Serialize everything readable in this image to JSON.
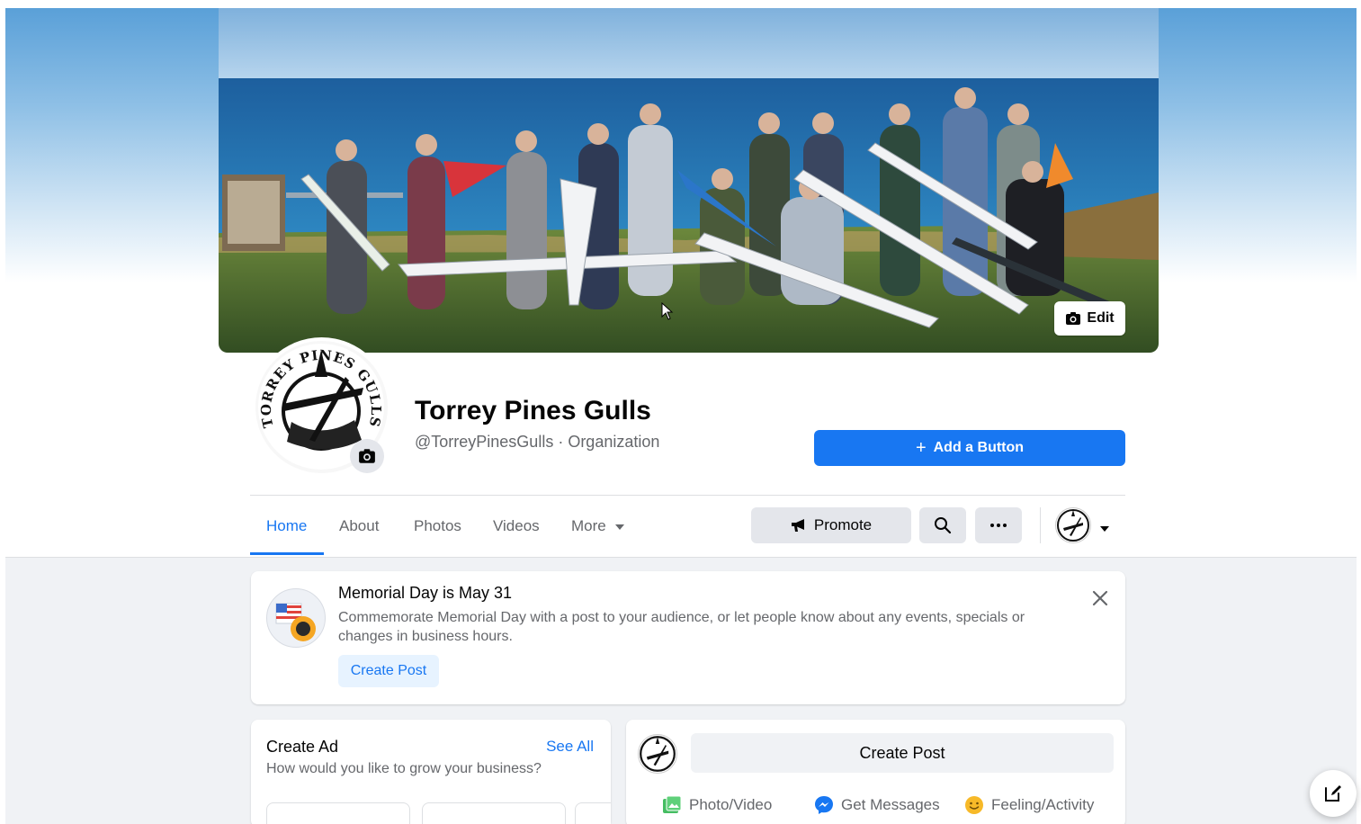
{
  "cover": {
    "edit_label": "Edit"
  },
  "page": {
    "name": "Torrey Pines Gulls",
    "handle": "@TorreyPinesGulls · Organization",
    "logo_text": "TORREY PINES GULLS"
  },
  "actions": {
    "add_button_label": "Add a Button"
  },
  "nav": {
    "tabs": [
      {
        "label": "Home",
        "active": true
      },
      {
        "label": "About"
      },
      {
        "label": "Photos"
      },
      {
        "label": "Videos"
      },
      {
        "label": "More"
      }
    ],
    "promote_label": "Promote"
  },
  "memorial": {
    "title": "Memorial Day is May 31",
    "body": "Commemorate Memorial Day with a post to your audience, or let people know about any events, specials or changes in business hours.",
    "cta": "Create Post"
  },
  "create_ad": {
    "title": "Create Ad",
    "see_all": "See All",
    "subtitle": "How would you like to grow your business?"
  },
  "create_post": {
    "button": "Create Post",
    "actions": [
      {
        "label": "Photo/Video",
        "icon": "photo-icon"
      },
      {
        "label": "Get Messages",
        "icon": "messenger-icon"
      },
      {
        "label": "Feeling/Activity",
        "icon": "smiley-icon"
      }
    ]
  },
  "colors": {
    "accent": "#1877f2",
    "page_bg": "#f0f2f5",
    "secondary_text": "#65676b"
  }
}
